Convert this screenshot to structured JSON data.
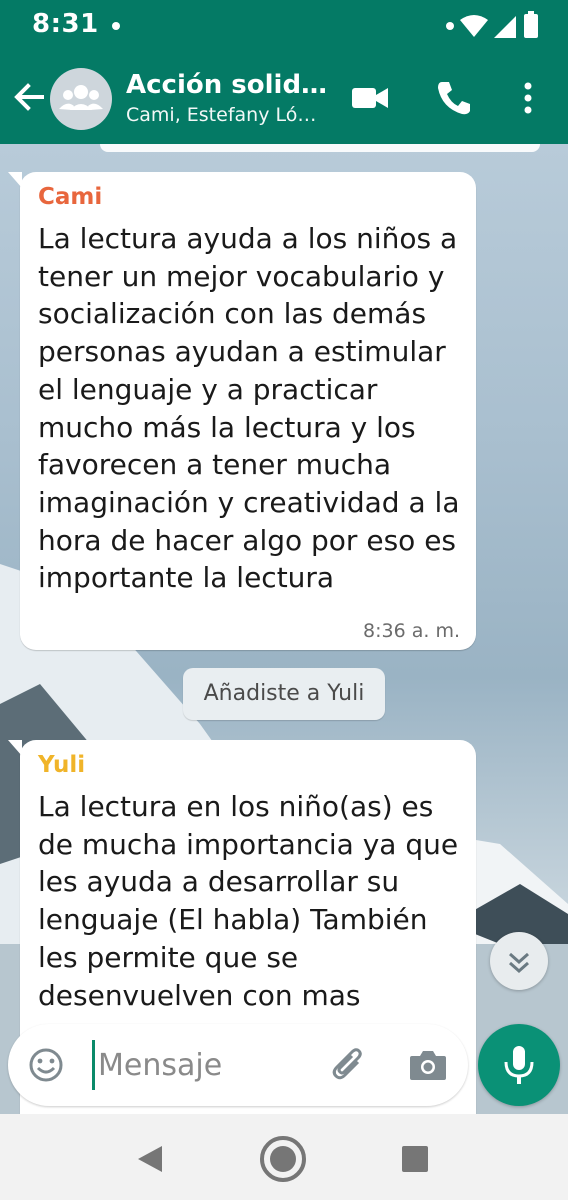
{
  "status_bar": {
    "time": "8:31"
  },
  "header": {
    "title": "Acción solid…",
    "subtitle": "Cami, Estefany Ló…"
  },
  "messages": [
    {
      "sender": "Cami",
      "sender_color": "#e8663d",
      "text": "La lectura ayuda a los niños a tener un mejor vocabulario y socialización con las demás personas ayudan a estimular el lenguaje y a practicar mucho más la lectura y los favorecen a tener mucha imaginación y creatividad a la hora de hacer algo por eso es importante la lectura",
      "time": "8:36 a. m."
    },
    {
      "sender": "Yuli",
      "sender_color": "#f0b429",
      "text": "La lectura en los niño(as) es de mucha importancia ya que les ayuda a desarrollar su lenguaje (El habla) También les permite que se desenvuelven con mas"
    }
  ],
  "system_message": "Añadiste a Yuli",
  "composer": {
    "placeholder": "Mensaje"
  },
  "colors": {
    "brand": "#047a65",
    "mic": "#0a9176"
  }
}
